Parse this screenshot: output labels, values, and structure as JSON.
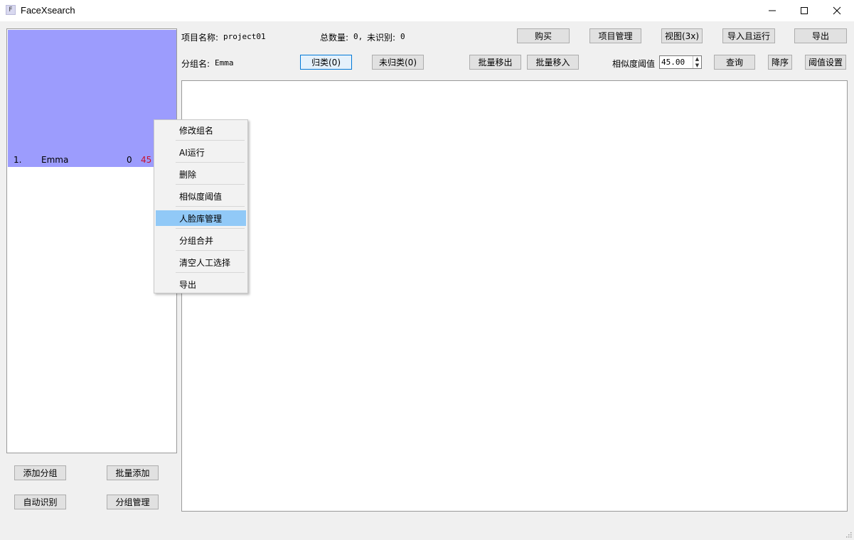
{
  "window": {
    "title": "FaceXsearch",
    "icon_letter": "F",
    "controls": [
      "minimize",
      "maximize",
      "close"
    ]
  },
  "header": {
    "project_label": "项目名称:",
    "project_name": "project01",
    "total_label": "总数量:",
    "total_value": "0,",
    "unrecognized_label": "未识别:",
    "unrecognized_value": "0",
    "group_label": "分组名:",
    "group_name": "Emma"
  },
  "toolbar": {
    "buy": "购买",
    "project_manage": "项目管理",
    "view": "视图(3x)",
    "import_run": "导入且运行",
    "export": "导出",
    "classified": "归类(0)",
    "unclassified": "未归类(0)",
    "batch_out": "批量移出",
    "batch_in": "批量移入",
    "similarity_label": "相似度阈值",
    "similarity_value": "45.00",
    "query": "查询",
    "sort_desc": "降序",
    "threshold_settings": "阈值设置"
  },
  "groups": [
    {
      "index": "1.",
      "name": "Emma",
      "count": "0",
      "unidentified": "45"
    }
  ],
  "sidebar_buttons": {
    "add_group": "添加分组",
    "batch_add": "批量添加",
    "auto_recognize": "自动识别",
    "group_manage": "分组管理"
  },
  "context_menu": {
    "items": [
      "修改组名",
      "AI运行",
      "删除",
      "相似度阈值",
      "人脸库管理",
      "分组合并",
      "清空人工选择",
      "导出"
    ],
    "highlighted": "人脸库管理"
  },
  "colors": {
    "selected_group_bg": "#9c9cfd",
    "unidentified_text": "#c8102e",
    "menu_highlight": "#91c9f7",
    "active_button_border": "#0078d7"
  }
}
